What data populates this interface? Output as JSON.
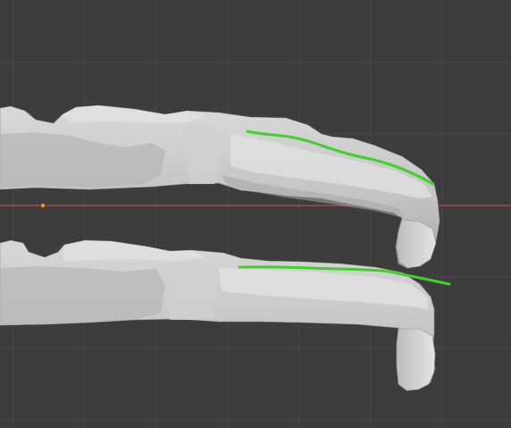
{
  "viewport": {
    "background_color": "#3d3d3d",
    "grid_color": "#474747",
    "x_axis_color": "#b84a52",
    "origin_color": "#e8931f",
    "mesh_color": "#c9c9c9",
    "mesh_shadow_color": "#9a9a9a",
    "mesh_highlight_color": "#e6e6e6",
    "annotation_color": "#3fd12a"
  },
  "objects": [
    {
      "name": "upper-denture-mesh",
      "kind": "sculpt-mesh"
    },
    {
      "name": "lower-denture-mesh",
      "kind": "sculpt-mesh"
    }
  ],
  "annotations": [
    {
      "name": "upper-occlusal-curve-stroke",
      "color": "#3fd12a"
    },
    {
      "name": "lower-occlusal-curve-stroke",
      "color": "#3fd12a"
    }
  ]
}
